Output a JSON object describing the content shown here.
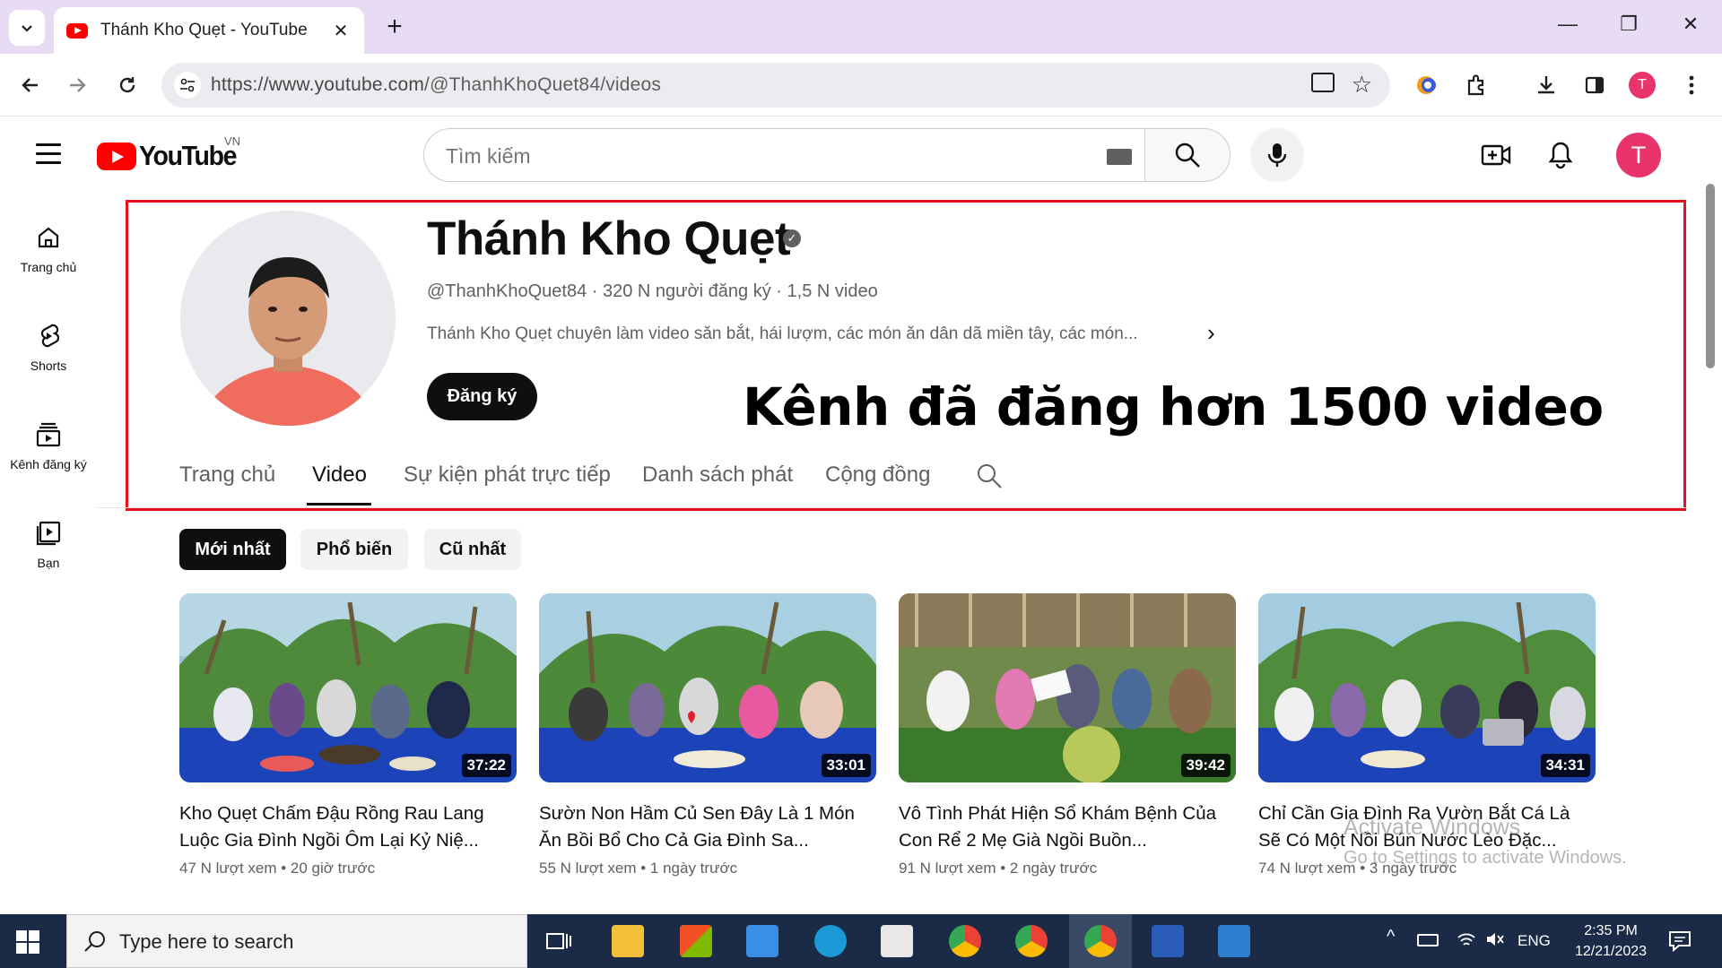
{
  "browser": {
    "tab_title": "Thánh Kho Quẹt - YouTube",
    "tab_close": "✕",
    "new_tab": "+",
    "url_host": "https://www.youtube.com",
    "url_path": "/@ThanhKhoQuet84/videos",
    "profile_initial": "T",
    "window_controls": {
      "minimize": "—",
      "restore": "❐",
      "close": "✕"
    }
  },
  "youtube": {
    "logo_text": "YouTube",
    "country_code": "VN",
    "search_placeholder": "Tìm kiếm",
    "avatar_initial": "T"
  },
  "guide": [
    {
      "label": "Trang chủ",
      "icon": "home-icon"
    },
    {
      "label": "Shorts",
      "icon": "shorts-icon"
    },
    {
      "label": "Kênh đăng ký",
      "icon": "subscriptions-icon"
    },
    {
      "label": "Bạn",
      "icon": "you-icon"
    }
  ],
  "channel": {
    "name": "Thánh Kho Quẹt",
    "verified_mark": "✓",
    "handle": "@ThanhKhoQuet84",
    "subscribers": "320 N người đăng ký",
    "video_count": "1,5 N video",
    "separator": "·",
    "description": "Thánh Kho Quẹt chuyên làm video săn bắt, hái lượm, các món ăn dân dã miền tây, các món...",
    "more_arrow": "›",
    "subscribe_label": "Đăng ký"
  },
  "annotation": {
    "text": "Kênh đã đăng hơn 1500 video",
    "box_color": "#e8101c"
  },
  "channel_tabs": [
    {
      "label": "Trang chủ",
      "active": false
    },
    {
      "label": "Video",
      "active": true
    },
    {
      "label": "Sự kiện phát trực tiếp",
      "active": false
    },
    {
      "label": "Danh sách phát",
      "active": false
    },
    {
      "label": "Cộng đồng",
      "active": false
    }
  ],
  "sort_chips": [
    {
      "label": "Mới nhất",
      "active": true
    },
    {
      "label": "Phổ biến",
      "active": false
    },
    {
      "label": "Cũ nhất",
      "active": false
    }
  ],
  "videos": [
    {
      "title": "Kho Quẹt Chấm Đậu Rồng Rau Lang Luộc Gia Đình Ngồi Ôm Lại Kỷ Niệ...",
      "duration": "37:22",
      "views": "47 N lượt xem",
      "age": "20 giờ trước"
    },
    {
      "title": "Sườn Non Hầm Củ Sen Đây Là 1 Món Ăn Bồi Bổ Cho Cả Gia Đình Sa...",
      "duration": "33:01",
      "views": "55 N lượt xem",
      "age": "1 ngày trước"
    },
    {
      "title": "Vô Tình Phát Hiện Sổ Khám Bệnh Của Con Rể 2 Mẹ Già Ngồi Buồn...",
      "duration": "39:42",
      "views": "91 N lượt xem",
      "age": "2 ngày trước"
    },
    {
      "title": "Chỉ Cần Gia Đình Ra Vườn Bắt Cá Là Sẽ Có Một Nồi Bún Nước Lèo Đặc...",
      "duration": "34:31",
      "views": "74 N lượt xem",
      "age": "3 ngày trước"
    }
  ],
  "meta_separator": "•",
  "watermark": {
    "line1": "Activate Windows",
    "line2": "Go to Settings to activate Windows."
  },
  "taskbar": {
    "search_placeholder": "Type here to search",
    "language": "ENG",
    "time": "2:35 PM",
    "date": "12/21/2023"
  },
  "colors": {
    "youtube_red": "#ff0000",
    "tab_strip": "#e8dcf5",
    "avatar_pink": "#e8336b",
    "taskbar": "#1b2a46"
  }
}
